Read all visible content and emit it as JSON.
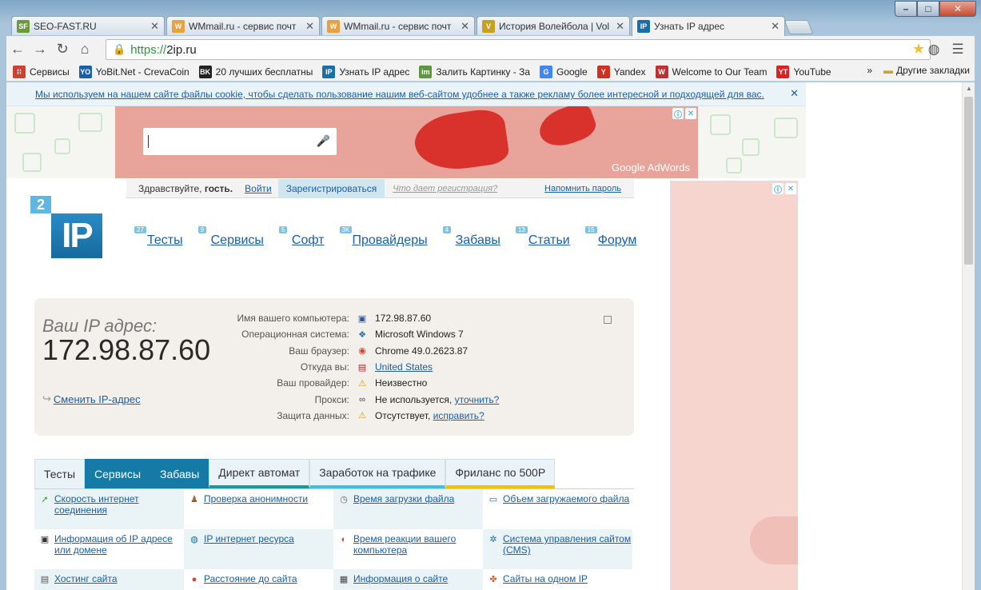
{
  "browser": {
    "tabs": [
      {
        "title": "SEO-FAST.RU",
        "favicon": "SF",
        "color": "#6a9a3a"
      },
      {
        "title": "WMmail.ru - сервис почт",
        "favicon": "W",
        "color": "#e8a040"
      },
      {
        "title": "WMmail.ru - сервис почт",
        "favicon": "W",
        "color": "#e8a040"
      },
      {
        "title": "История Волейбола | Vol",
        "favicon": "V",
        "color": "#c8a020"
      },
      {
        "title": "Узнать IP адрес",
        "favicon": "IP",
        "color": "#1a6fa8"
      }
    ],
    "url_scheme": "https://",
    "url_host": "2ip.ru",
    "bookmarks": [
      {
        "label": "Сервисы",
        "icon": "apps-icon",
        "color": "#d04030"
      },
      {
        "label": "YoBit.Net - CrevaCoin",
        "icon": "YO",
        "color": "#1a5fa8"
      },
      {
        "label": "20 лучших бесплатны",
        "icon": "BK",
        "color": "#222"
      },
      {
        "label": "Узнать IP адрес",
        "icon": "IP",
        "color": "#1a6fa8"
      },
      {
        "label": "Залить Картинку - За",
        "icon": "img",
        "color": "#5a9a3a"
      },
      {
        "label": "Google",
        "icon": "G",
        "color": "#4285f4"
      },
      {
        "label": "Yandex",
        "icon": "Y",
        "color": "#d03020"
      },
      {
        "label": "Welcome to Our Team",
        "icon": "W",
        "color": "#c03030"
      },
      {
        "label": "YouTube",
        "icon": "YT",
        "color": "#e02020"
      }
    ],
    "other_bookmarks": "Другие закладки"
  },
  "cookie": {
    "text": "Мы используем на нашем сайте файлы cookie, чтобы сделать пользование нашим веб-сайтом удобнее а также рекламу более интересной и подходящей для вас."
  },
  "ad": {
    "brand": "Google AdWords"
  },
  "login": {
    "greeting": "Здравствуйте, ",
    "guest": "гость.",
    "login": "Войти",
    "register": "Зарегистрироваться",
    "why": "Что дает регистрация?",
    "remind": "Напомнить пароль"
  },
  "logo": {
    "two": "2",
    "ip": "IP"
  },
  "menu": [
    {
      "label": "Тесты",
      "count": "27"
    },
    {
      "label": "Сервисы",
      "count": "9"
    },
    {
      "label": "Софт",
      "count": "5"
    },
    {
      "label": "Провайдеры",
      "count": "3K"
    },
    {
      "label": "Забавы",
      "count": "4"
    },
    {
      "label": "Статьи",
      "count": "13"
    },
    {
      "label": "Форум",
      "count": "15"
    }
  ],
  "ipinfo": {
    "label": "Ваш IP адрес:",
    "ip": "172.98.87.60",
    "change": "Сменить IP-адрес",
    "rows": [
      {
        "key": "Имя вашего компьютера:",
        "value": "172.98.87.60",
        "link": "",
        "icon": "computer-icon"
      },
      {
        "key": "Операционная система:",
        "value": "Microsoft Windows 7",
        "link": "",
        "icon": "windows-icon"
      },
      {
        "key": "Ваш браузер:",
        "value": "Chrome 49.0.2623.87",
        "link": "",
        "icon": "chrome-icon"
      },
      {
        "key": "Откуда вы:",
        "value": "",
        "link": "United States",
        "icon": "flag-icon"
      },
      {
        "key": "Ваш провайдер:",
        "value": "Неизвестно",
        "link": "",
        "icon": "warning-icon"
      },
      {
        "key": "Прокси:",
        "value": "Не используется, ",
        "link": "уточнить?",
        "icon": "glasses-icon"
      },
      {
        "key": "Защита данных:",
        "value": "Отсутствует, ",
        "link": "исправить?",
        "icon": "warning-icon"
      }
    ]
  },
  "page_tabs": [
    {
      "label": "Тесты",
      "style": ""
    },
    {
      "label": "Сервисы",
      "style": "on"
    },
    {
      "label": "Забавы",
      "style": "on"
    },
    {
      "label": "Директ автомат",
      "style": "s1"
    },
    {
      "label": "Заработок на трафике",
      "style": "s2"
    },
    {
      "label": "Фриланс по 500Р",
      "style": "s3"
    }
  ],
  "services": [
    [
      {
        "label": "Скорость интернет соединения",
        "icon": "speed-icon"
      },
      {
        "label": "Проверка анонимности",
        "icon": "person-icon"
      },
      {
        "label": "Время загрузки файла",
        "icon": "clock-icon"
      },
      {
        "label": "Объем загружаемого файла",
        "icon": "file-icon"
      }
    ],
    [
      {
        "label": "Информация об IP адресе или домене",
        "icon": "ip-icon"
      },
      {
        "label": "IP интернет ресурса",
        "icon": "ip-globe-icon"
      },
      {
        "label": "Время реакции вашего компьютера",
        "icon": "reaction-icon"
      },
      {
        "label": "Система управления сайтом (CMS)",
        "icon": "cms-icon"
      }
    ],
    [
      {
        "label": "Хостинг сайта",
        "icon": "hosting-icon"
      },
      {
        "label": "Расстояние до сайта",
        "icon": "pin-icon"
      },
      {
        "label": "Информация о сайте",
        "icon": "info-icon"
      },
      {
        "label": "Сайты на одном IP",
        "icon": "sites-icon"
      }
    ]
  ]
}
